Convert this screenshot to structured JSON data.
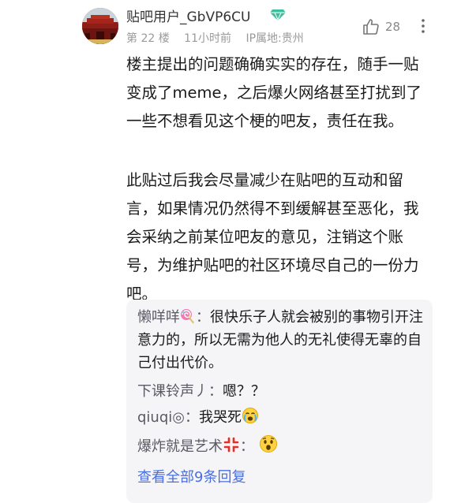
{
  "post": {
    "username": "贴吧用户_GbVP6CU",
    "floor": "第 22 楼",
    "time": "11小时前",
    "location": "IP属地:贵州",
    "likes": "28",
    "paragraph1": "楼主提出的问题确确实实的存在，随手一贴变成了meme，之后爆火网络甚至打扰到了一些不想看见这个梗的吧友，责任在我。",
    "paragraph2": "此贴过后我会尽量减少在贴吧的互动和留言，如果情况仍然得不到缓解甚至恶化，我会采纳之前某位吧友的意见，注销这个账号，为维护贴吧的社区环境尽自己的一份力吧。"
  },
  "replies": [
    {
      "user": "懒咩咩",
      "sep": "：",
      "text": "很快乐子人就会被别的事物引开注意力的，所以无需为他人的无礼使得无辜的自己付出代价。"
    },
    {
      "user": "下课铃声丿",
      "sep": "：",
      "text": "嗯？？"
    },
    {
      "user": "qiuqi◎",
      "sep": "：",
      "text": "我哭死"
    },
    {
      "user": "爆炸就是艺术",
      "sep": "：",
      "text": ""
    }
  ],
  "view_all": "查看全部9条回复",
  "colors": {
    "link": "#4a6ee0",
    "meta": "#9a9a9a",
    "reply_bg": "#f5f5f7",
    "badge": "#3dbf9b"
  },
  "icons": [
    "avatar-image",
    "diamond-badge-icon",
    "thumb-up-icon",
    "more-vertical-icon",
    "lollipop-emoji",
    "crying-emoji",
    "anger-emoji",
    "shocked-emoji"
  ]
}
